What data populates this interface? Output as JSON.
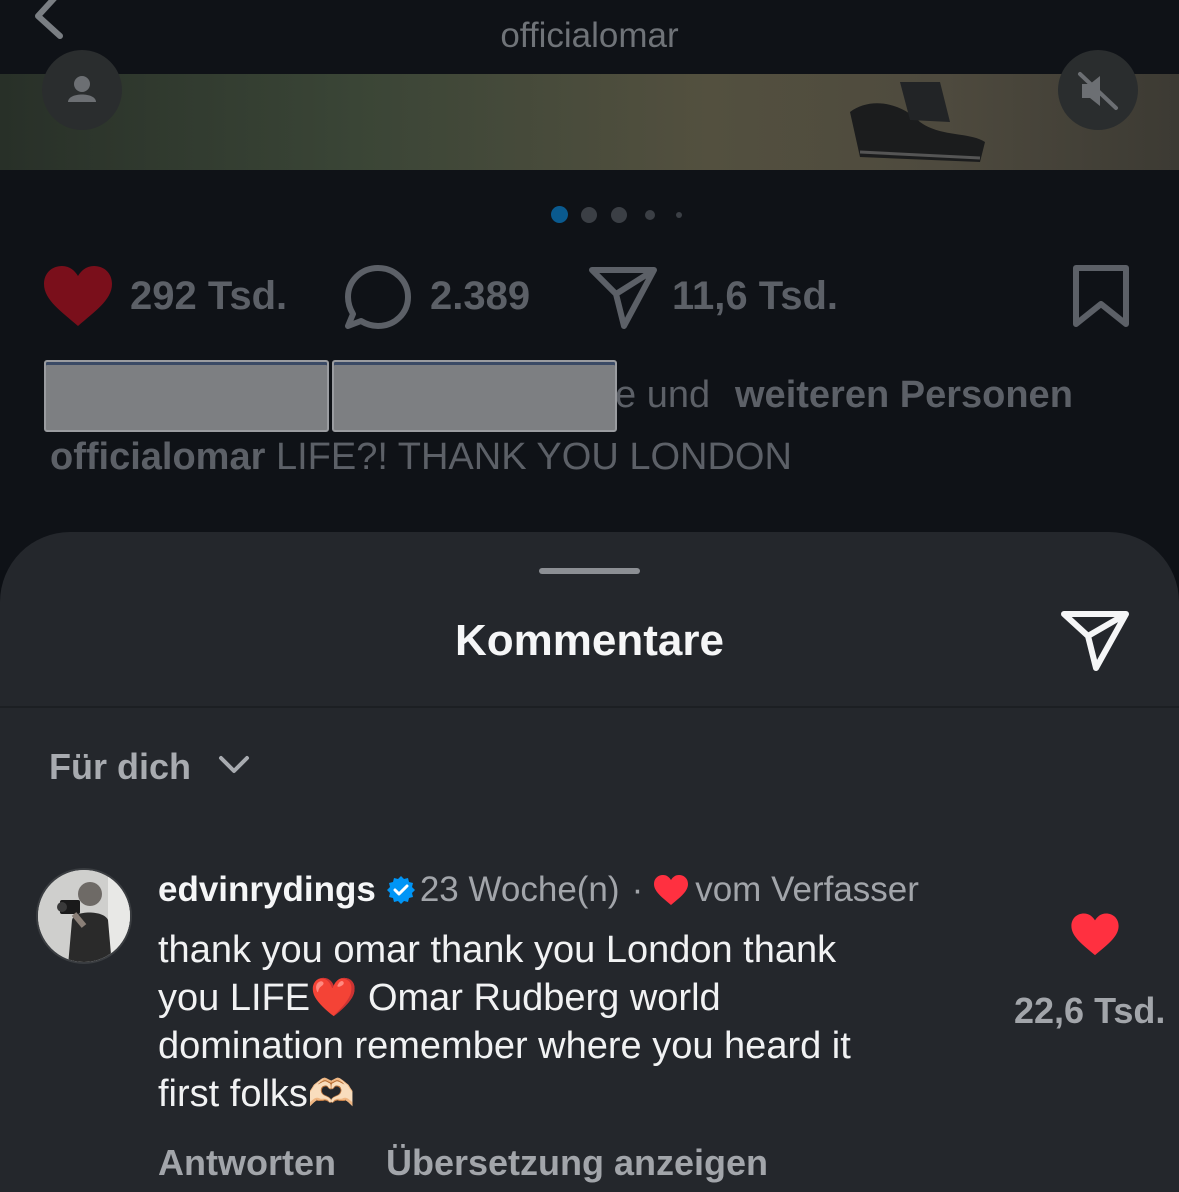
{
  "header": {
    "handle": "officialomar"
  },
  "post": {
    "likes": "292 Tsd.",
    "comments": "2.389",
    "shares": "11,6 Tsd.",
    "liked_by_suffix_part1": "e und ",
    "liked_by_suffix_part2": "weiteren Personen",
    "caption_user": "officialomar",
    "caption_text": " LIFE?! THANK YOU LONDON",
    "carousel_total": 5,
    "carousel_active": 1
  },
  "sheet": {
    "title": "Kommentare",
    "filter_label": "Für dich"
  },
  "comment": {
    "username": "edvinrydings",
    "age": "23 Woche(n)",
    "separator": "·",
    "author_like_label": "vom Verfasser",
    "body_line1": "thank you omar thank you London thank",
    "body_line2_a": "you LIFE",
    "body_line2_emoji": "❤️",
    "body_line2_b": " Omar Rudberg world",
    "body_line3": "domination remember where you heard it",
    "body_line4": "first folks",
    "body_line4_emoji": "🫶🏻",
    "like_count": "22,6 Tsd.",
    "reply_label": "Antworten",
    "translate_label": "Übersetzung anzeigen"
  },
  "colors": {
    "heart_dim": "#7a0f1b",
    "heart_red": "#ff3040",
    "verified_blue": "#0095f6",
    "dot_active": "#0a5a8f"
  }
}
